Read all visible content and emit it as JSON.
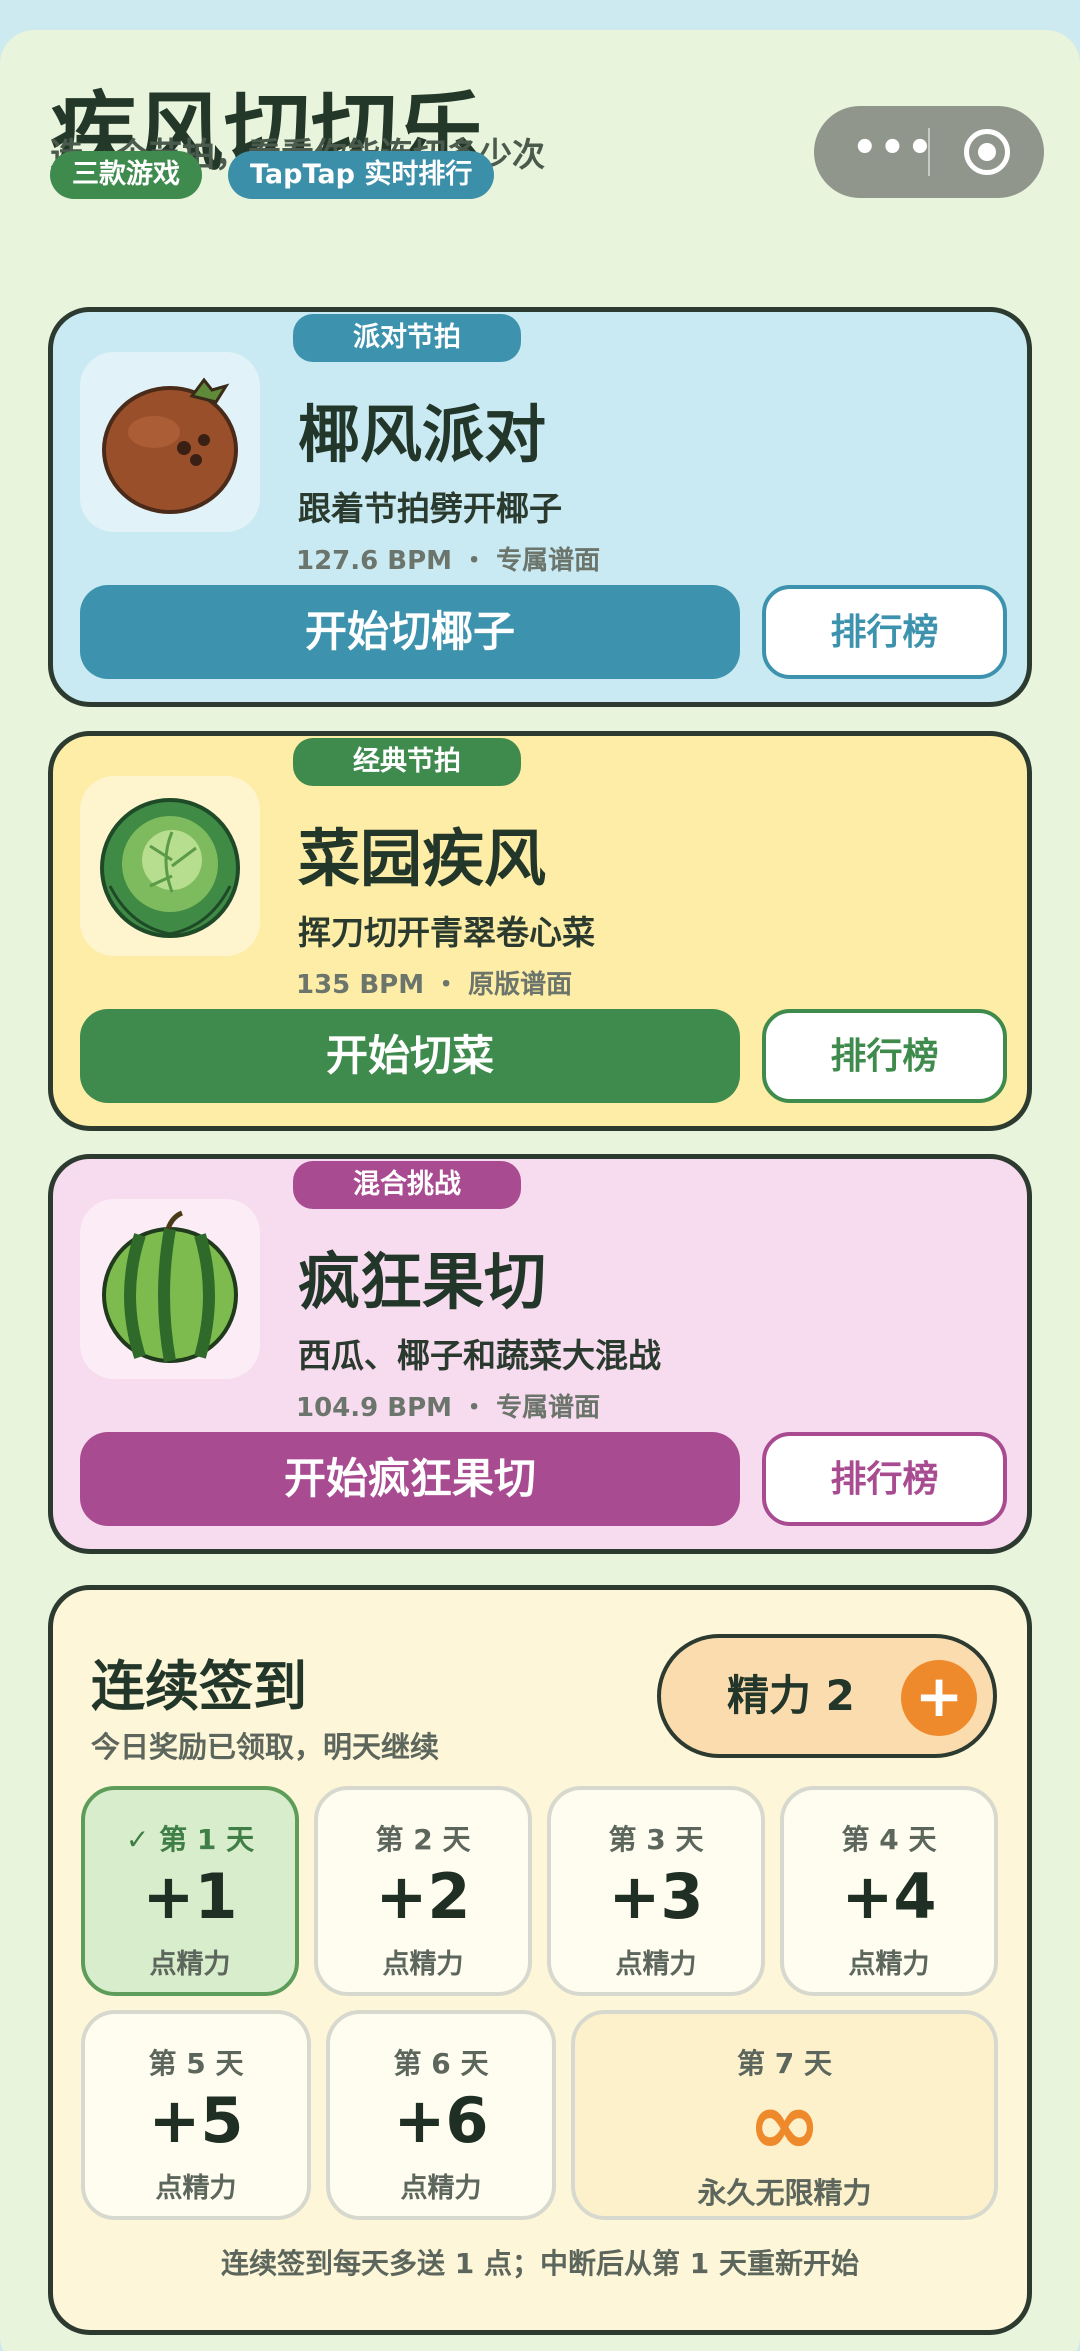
{
  "header": {
    "title": "疾风切切乐",
    "subtitle": "选一个节拍，看看你能连切多少次",
    "pills": [
      "三款游戏",
      "TapTap 实时排行"
    ],
    "capsule": {
      "more_icon": "more-dots-icon",
      "close_icon": "target-icon"
    }
  },
  "games": [
    {
      "tag": "派对节拍",
      "name": "椰风派对",
      "desc": "跟着节拍劈开椰子",
      "meta": "127.6 BPM ・ 专属谱面",
      "start_label": "开始切椰子",
      "rank_label": "排行榜",
      "image_icon": "coconut-icon",
      "accent": "#3d93ad"
    },
    {
      "tag": "经典节拍",
      "name": "菜园疾风",
      "desc": "挥刀切开青翠卷心菜",
      "meta": "135 BPM ・ 原版谱面",
      "start_label": "开始切菜",
      "rank_label": "排行榜",
      "image_icon": "cabbage-icon",
      "accent": "#3f8b4d"
    },
    {
      "tag": "混合挑战",
      "name": "疯狂果切",
      "desc": "西瓜、椰子和蔬菜大混战",
      "meta": "104.9 BPM ・ 专属谱面",
      "start_label": "开始疯狂果切",
      "rank_label": "排行榜",
      "image_icon": "watermelon-icon",
      "accent": "#a84b91"
    }
  ],
  "checkin": {
    "title": "连续签到",
    "subtitle": "今日奖励已领取，明天继续",
    "stamina_label": "精力 2",
    "stamina_plus": "+",
    "days": [
      {
        "label": "✓ 第 1 天",
        "value": "+1",
        "unit": "点精力",
        "claimed": true
      },
      {
        "label": "第 2 天",
        "value": "+2",
        "unit": "点精力",
        "claimed": false
      },
      {
        "label": "第 3 天",
        "value": "+3",
        "unit": "点精力",
        "claimed": false
      },
      {
        "label": "第 4 天",
        "value": "+4",
        "unit": "点精力",
        "claimed": false
      },
      {
        "label": "第 5 天",
        "value": "+5",
        "unit": "点精力",
        "claimed": false
      },
      {
        "label": "第 6 天",
        "value": "+6",
        "unit": "点精力",
        "claimed": false
      },
      {
        "label": "第 7 天",
        "value": "∞",
        "unit": "永久无限精力",
        "claimed": false
      }
    ],
    "footer": "连续签到每天多送 1 点；中断后从第 1 天重新开始"
  }
}
